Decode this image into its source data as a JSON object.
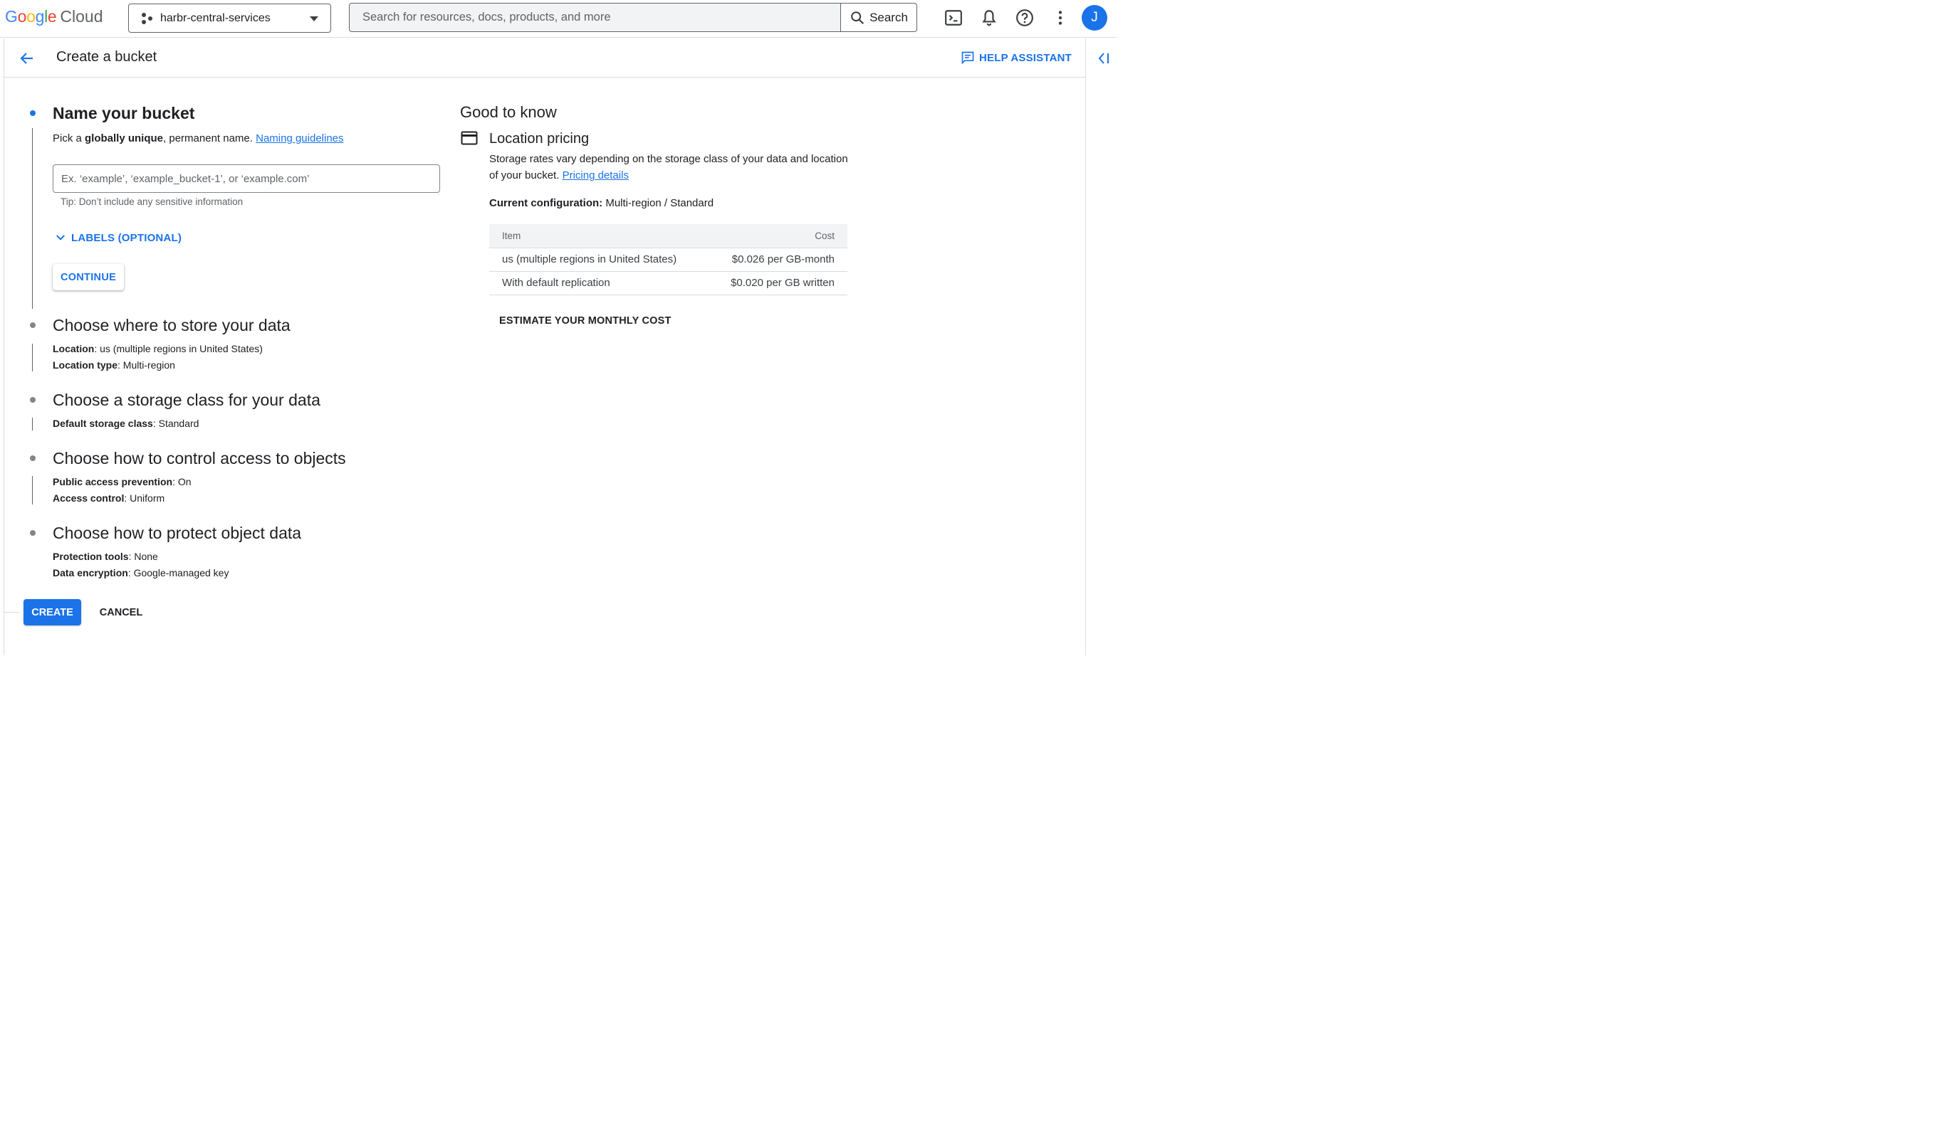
{
  "brand": {
    "logo_google": "Google",
    "logo_cloud": "Cloud",
    "logo_colors": [
      "#4285F4",
      "#EA4335",
      "#FBBC05",
      "#4285F4",
      "#34A853",
      "#EA4335"
    ]
  },
  "topbar": {
    "project_name": "harbr-central-services",
    "search_placeholder": "Search for resources, docs, products, and more",
    "search_button": "Search",
    "avatar_initial": "J",
    "icons": [
      "project-picker-icon",
      "chevron-down-icon",
      "search-icon",
      "cloud-shell-icon",
      "notifications-bell-icon",
      "help-icon",
      "more-vert-icon"
    ]
  },
  "header": {
    "title": "Create a bucket",
    "help_assistant": "HELP ASSISTANT"
  },
  "steps": {
    "name": {
      "title": "Name your bucket",
      "desc_pre": "Pick a ",
      "desc_bold": "globally unique",
      "desc_post": ", permanent name. ",
      "desc_link": "Naming guidelines",
      "input_placeholder": "Ex. ‘example’, ‘example_bucket-1’, or ‘example.com’",
      "tip": "Tip: Don’t include any sensitive information",
      "labels_toggle": "LABELS (OPTIONAL)",
      "continue": "CONTINUE"
    },
    "location": {
      "title": "Choose where to store your data",
      "location_key": "Location",
      "location_val": ": us (multiple regions in United States)",
      "type_key": "Location type",
      "type_val": ": Multi-region"
    },
    "storage": {
      "title": "Choose a storage class for your data",
      "class_key": "Default storage class",
      "class_val": ": Standard"
    },
    "access": {
      "title": "Choose how to control access to objects",
      "pap_key": "Public access prevention",
      "pap_val": ": On",
      "ac_key": "Access control",
      "ac_val": ": Uniform"
    },
    "protect": {
      "title": "Choose how to protect object data",
      "tools_key": "Protection tools",
      "tools_val": ": None",
      "enc_key": "Data encryption",
      "enc_val": ": Google-managed key"
    }
  },
  "actions": {
    "create": "CREATE",
    "cancel": "CANCEL"
  },
  "good_to_know": {
    "heading": "Good to know",
    "pricing_title": "Location pricing",
    "pricing_desc": "Storage rates vary depending on the storage class of your data and location of your bucket. ",
    "pricing_link": "Pricing details",
    "current_key": "Current configuration:",
    "current_val": " Multi-region / Standard",
    "table": {
      "headers": [
        "Item",
        "Cost"
      ],
      "rows": [
        [
          "us (multiple regions in United States)",
          "$0.026 per GB-month"
        ],
        [
          "With default replication",
          "$0.020 per GB written"
        ]
      ]
    },
    "estimate": "ESTIMATE YOUR MONTHLY COST"
  },
  "colors": {
    "accent": "#1a73e8",
    "text": "#202124",
    "muted": "#5f6368",
    "divider": "#dadce0"
  }
}
